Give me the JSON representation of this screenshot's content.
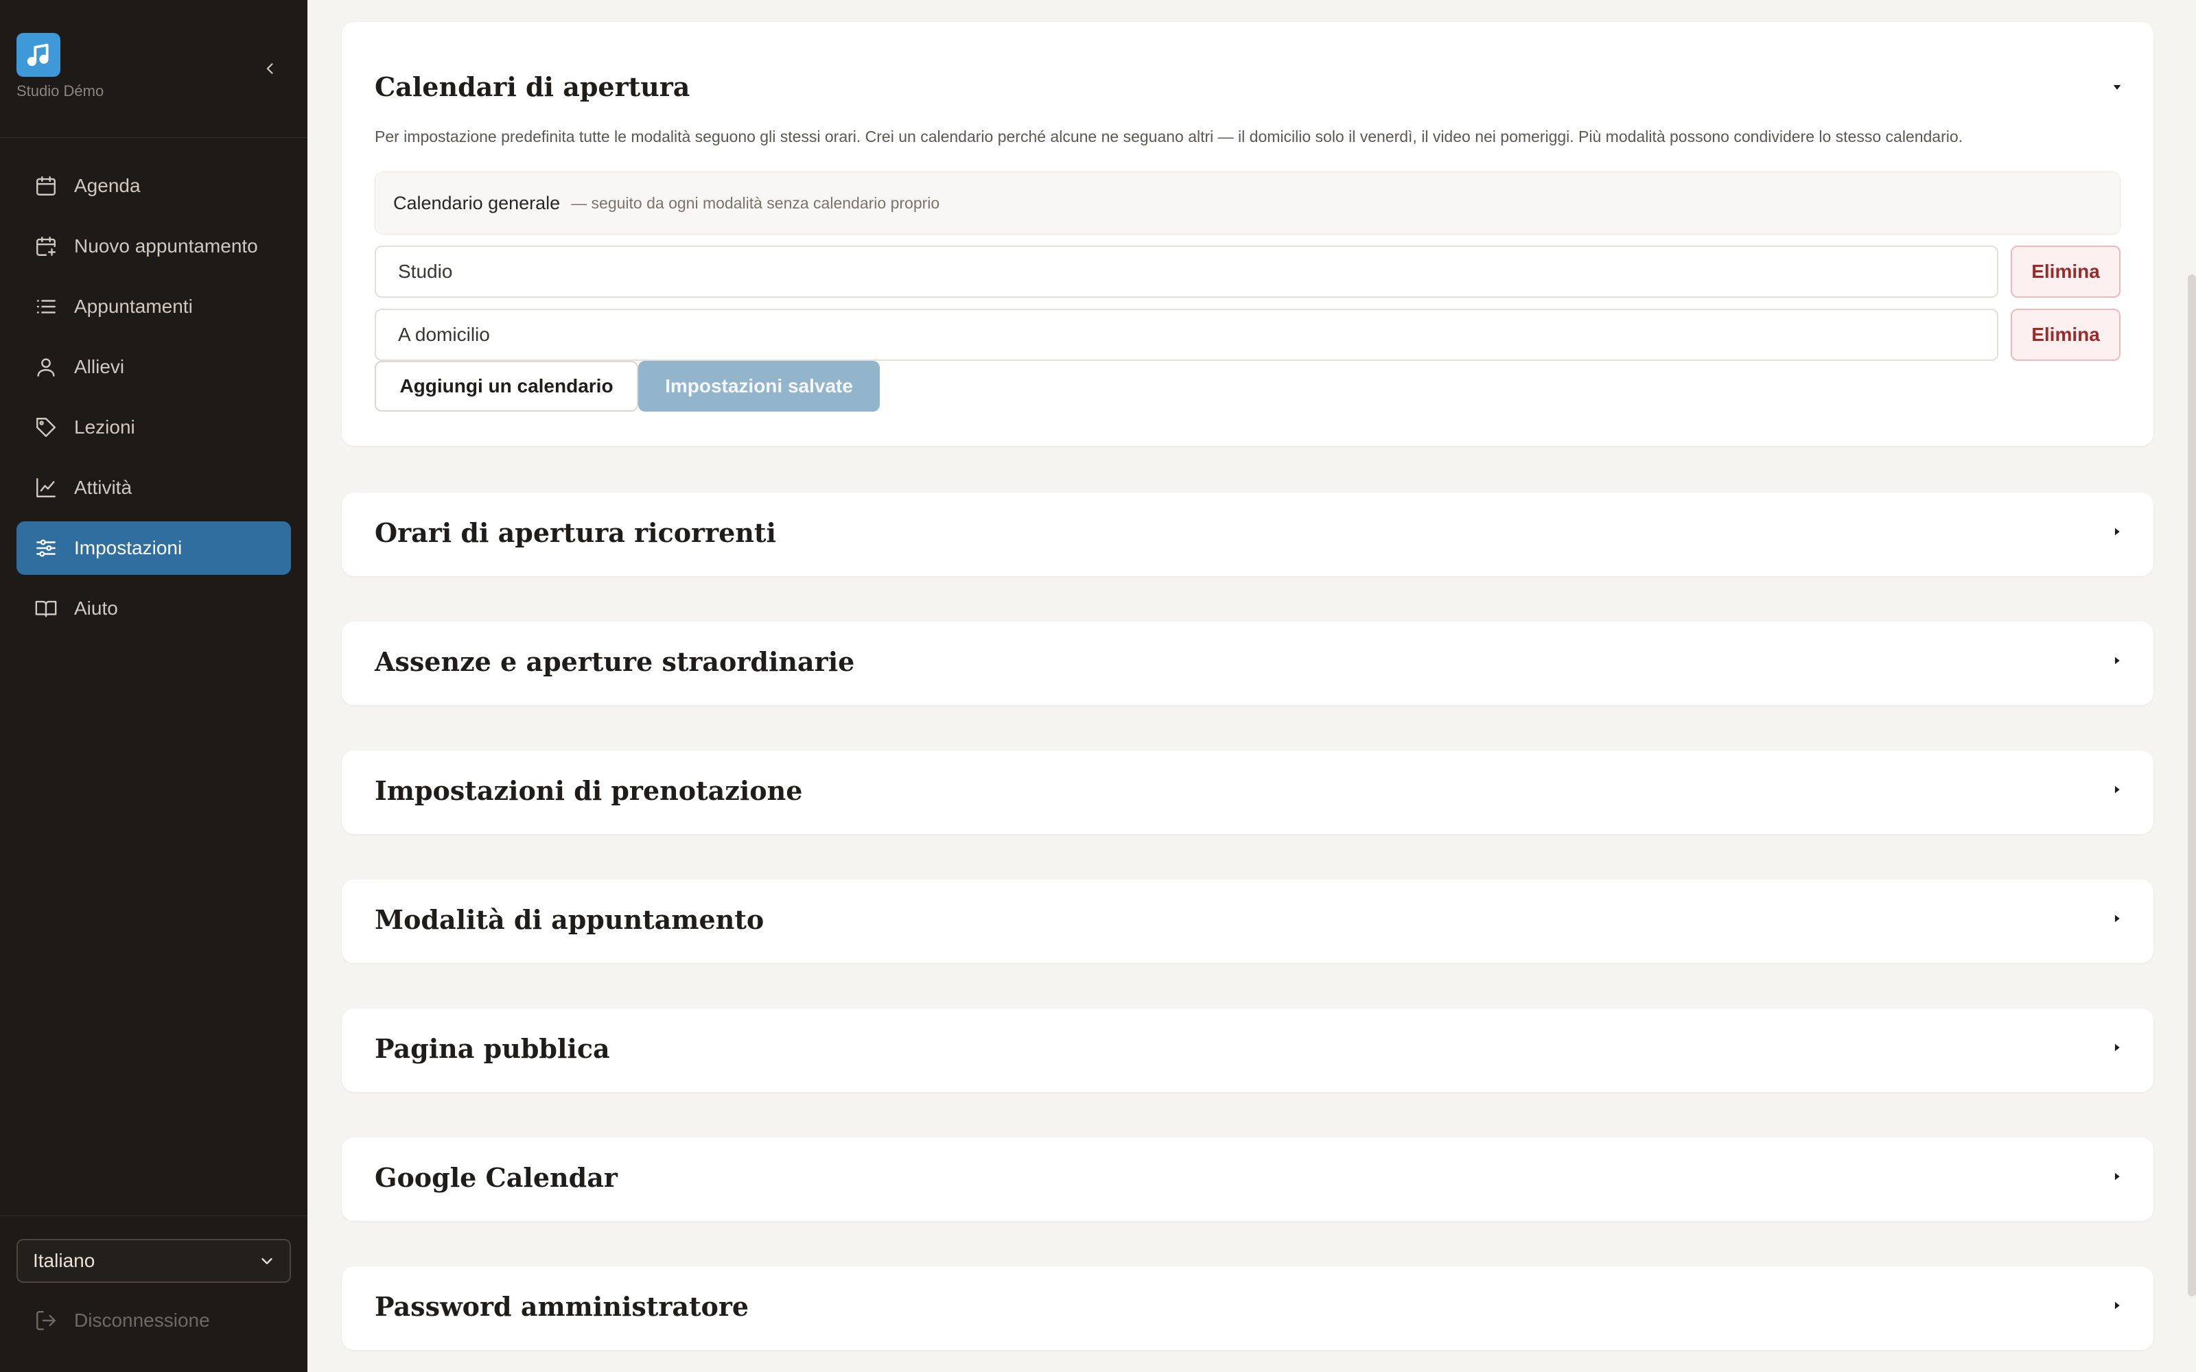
{
  "brand": {
    "name": "Studio Démo",
    "logo_icon": "music-note-icon",
    "accent": "#3f98d8"
  },
  "sidebar": {
    "items": [
      {
        "label": "Agenda",
        "icon": "calendar-icon"
      },
      {
        "label": "Nuovo appuntamento",
        "icon": "calendar-plus-icon"
      },
      {
        "label": "Appuntamenti",
        "icon": "list-icon"
      },
      {
        "label": "Allievi",
        "icon": "user-icon"
      },
      {
        "label": "Lezioni",
        "icon": "tag-icon"
      },
      {
        "label": "Attività",
        "icon": "chart-line-icon"
      },
      {
        "label": "Impostazioni",
        "icon": "sliders-icon",
        "active": true
      },
      {
        "label": "Aiuto",
        "icon": "book-icon"
      }
    ],
    "language": "Italiano",
    "logout": "Disconnessione",
    "active_color": "#2f6e9e"
  },
  "calendars": {
    "title": "Calendari di apertura",
    "description": "Per impostazione predefinita tutte le modalità seguono gli stessi orari. Crei un calendario perché alcune ne seguano altri — il domicilio solo il venerdì, il video nei pomeriggi. Più modalità possono condividere lo stesso calendario.",
    "general_name": "Calendario generale",
    "general_note": "— seguito da ogni modalità senza calendario proprio",
    "rows": [
      {
        "value": "Studio",
        "delete_label": "Elimina"
      },
      {
        "value": "A domicilio",
        "delete_label": "Elimina"
      }
    ],
    "add_label": "Aggiungi un calendario",
    "saved_label": "Impostazioni salvate"
  },
  "sections": [
    {
      "title": "Orari di apertura ricorrenti"
    },
    {
      "title": "Assenze e aperture straordinarie"
    },
    {
      "title": "Impostazioni di prenotazione"
    },
    {
      "title": "Modalità di appuntamento"
    },
    {
      "title": "Pagina pubblica"
    },
    {
      "title": "Google Calendar"
    },
    {
      "title": "Password amministratore"
    }
  ]
}
